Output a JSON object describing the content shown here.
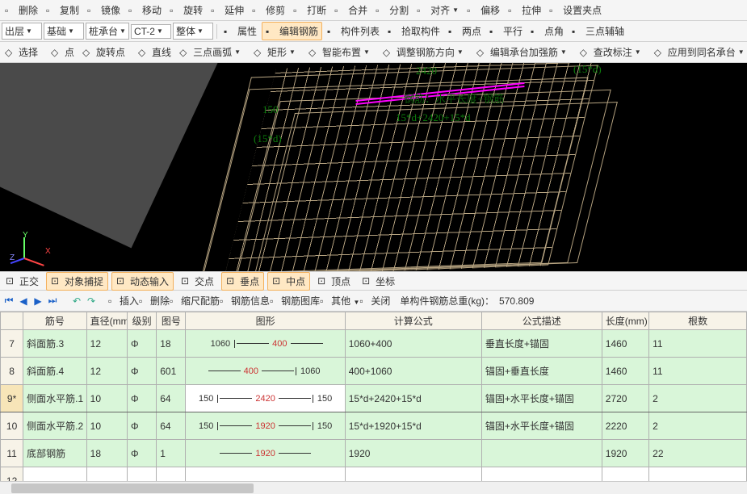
{
  "toolbars": {
    "row1": [
      {
        "label": "删除",
        "icon": "x"
      },
      {
        "label": "复制",
        "icon": "copy"
      },
      {
        "label": "镜像",
        "icon": "mirror"
      },
      {
        "label": "移动",
        "icon": "move"
      },
      {
        "label": "旋转",
        "icon": "rot"
      },
      {
        "label": "延伸",
        "icon": "ext"
      },
      {
        "label": "修剪",
        "icon": "trim"
      },
      {
        "label": "打断",
        "icon": "break"
      },
      {
        "label": "合并",
        "icon": "merge"
      },
      {
        "label": "分割",
        "icon": "split"
      },
      {
        "label": "对齐",
        "icon": "align",
        "dd": true
      },
      {
        "label": "偏移",
        "icon": "offset"
      },
      {
        "label": "拉伸",
        "icon": "stretch"
      },
      {
        "label": "设置夹点",
        "icon": "grip"
      }
    ],
    "row2": {
      "dd": [
        {
          "label": "出层"
        },
        {
          "label": "基础"
        },
        {
          "label": "桩承台"
        },
        {
          "label": "CT-2"
        },
        {
          "label": "整体"
        }
      ],
      "btns": [
        {
          "label": "属性",
          "icon": "prop"
        },
        {
          "label": "编辑钢筋",
          "icon": "rebar",
          "active": true
        },
        {
          "label": "构件列表",
          "icon": "list"
        },
        {
          "label": "拾取构件",
          "icon": "pick"
        },
        {
          "label": "两点",
          "icon": "2pt"
        },
        {
          "label": "平行",
          "icon": "para"
        },
        {
          "label": "点角",
          "icon": "ptang"
        },
        {
          "label": "三点辅轴",
          "icon": "3pt"
        }
      ]
    },
    "row3": {
      "btns": [
        {
          "label": "选择"
        },
        {
          "label": "点"
        },
        {
          "label": "旋转点"
        },
        {
          "label": "直线"
        },
        {
          "label": "三点画弧"
        },
        {
          "label": "矩形"
        },
        {
          "label": "智能布置"
        },
        {
          "label": "调整钢筋方向"
        },
        {
          "label": "编辑承台加强筋"
        },
        {
          "label": "查改标注"
        },
        {
          "label": "应用到同名承台"
        }
      ]
    }
  },
  "annotations": {
    "a1": "2420",
    "a2": "(15*d)",
    "a3": "150",
    "a4": "(15*d)",
    "a5": "钢筋：水平长度+钢筋",
    "a6": "15*d+2420+15*d"
  },
  "axis": {
    "y": "Y",
    "x": "X",
    "z": "Z"
  },
  "snapbar": [
    {
      "label": "正交",
      "icon": "ortho"
    },
    {
      "label": "对象捕捉",
      "icon": "osnap",
      "active": true
    },
    {
      "label": "动态输入",
      "icon": "dyn",
      "active": true
    },
    {
      "label": "交点",
      "icon": "int"
    },
    {
      "label": "垂点",
      "icon": "perp",
      "active": true
    },
    {
      "label": "中点",
      "icon": "mid",
      "active": true
    },
    {
      "label": "顶点",
      "icon": "vert"
    },
    {
      "label": "坐标",
      "icon": "coord"
    }
  ],
  "midbar": {
    "btns": [
      {
        "label": "插入"
      },
      {
        "label": "删除"
      },
      {
        "label": "缩尺配筋"
      },
      {
        "label": "钢筋信息"
      },
      {
        "label": "钢筋图库"
      },
      {
        "label": "其他"
      },
      {
        "label": "关闭"
      }
    ],
    "weightLabel": "单构件钢筋总重(kg)：",
    "weight": "570.809"
  },
  "grid": {
    "headers": [
      "",
      "筋号",
      "直径(mm)",
      "级别",
      "图号",
      "图形",
      "计算公式",
      "公式描述",
      "长度(mm)",
      "根数"
    ],
    "widths": [
      28,
      78,
      50,
      36,
      36,
      196,
      168,
      148,
      58,
      120
    ],
    "rows": [
      {
        "n": "7",
        "name": "斜面筋.3",
        "dia": "12",
        "grade": "Φ",
        "fig": "18",
        "shape": {
          "pre": "1060",
          "main": "400",
          "post": "",
          "left_hook": true,
          "right_hook": false
        },
        "formula": "1060+400",
        "desc": "垂直长度+锚固",
        "len": "1460",
        "count": "11"
      },
      {
        "n": "8",
        "name": "斜面筋.4",
        "dia": "12",
        "grade": "Φ",
        "fig": "601",
        "shape": {
          "pre": "",
          "main": "400",
          "post": "1060",
          "left_hook": false,
          "right_hook": true
        },
        "formula": "400+1060",
        "desc": "锚固+垂直长度",
        "len": "1460",
        "count": "11"
      },
      {
        "n": "9*",
        "name": "侧面水平筋.1",
        "dia": "10",
        "grade": "Φ",
        "fig": "64",
        "shape": {
          "pre": "150",
          "main": "2420",
          "post": "150",
          "left_hook": true,
          "right_hook": true
        },
        "formula": "15*d+2420+15*d",
        "desc": "锚固+水平长度+锚固",
        "len": "2720",
        "count": "2",
        "selected": true
      },
      {
        "n": "10",
        "name": "侧面水平筋.2",
        "dia": "10",
        "grade": "Φ",
        "fig": "64",
        "shape": {
          "pre": "150",
          "main": "1920",
          "post": "150",
          "left_hook": true,
          "right_hook": true
        },
        "formula": "15*d+1920+15*d",
        "desc": "锚固+水平长度+锚固",
        "len": "2220",
        "count": "2"
      },
      {
        "n": "11",
        "name": "底部钢筋",
        "dia": "18",
        "grade": "Φ",
        "fig": "1",
        "shape": {
          "pre": "",
          "main": "1920",
          "post": "",
          "left_hook": false,
          "right_hook": false
        },
        "formula": "1920",
        "desc": "",
        "len": "1920",
        "count": "22"
      },
      {
        "n": "12",
        "name": "",
        "dia": "",
        "grade": "",
        "fig": "",
        "shape": null,
        "formula": "",
        "desc": "",
        "len": "",
        "count": "",
        "empty": true
      }
    ]
  }
}
